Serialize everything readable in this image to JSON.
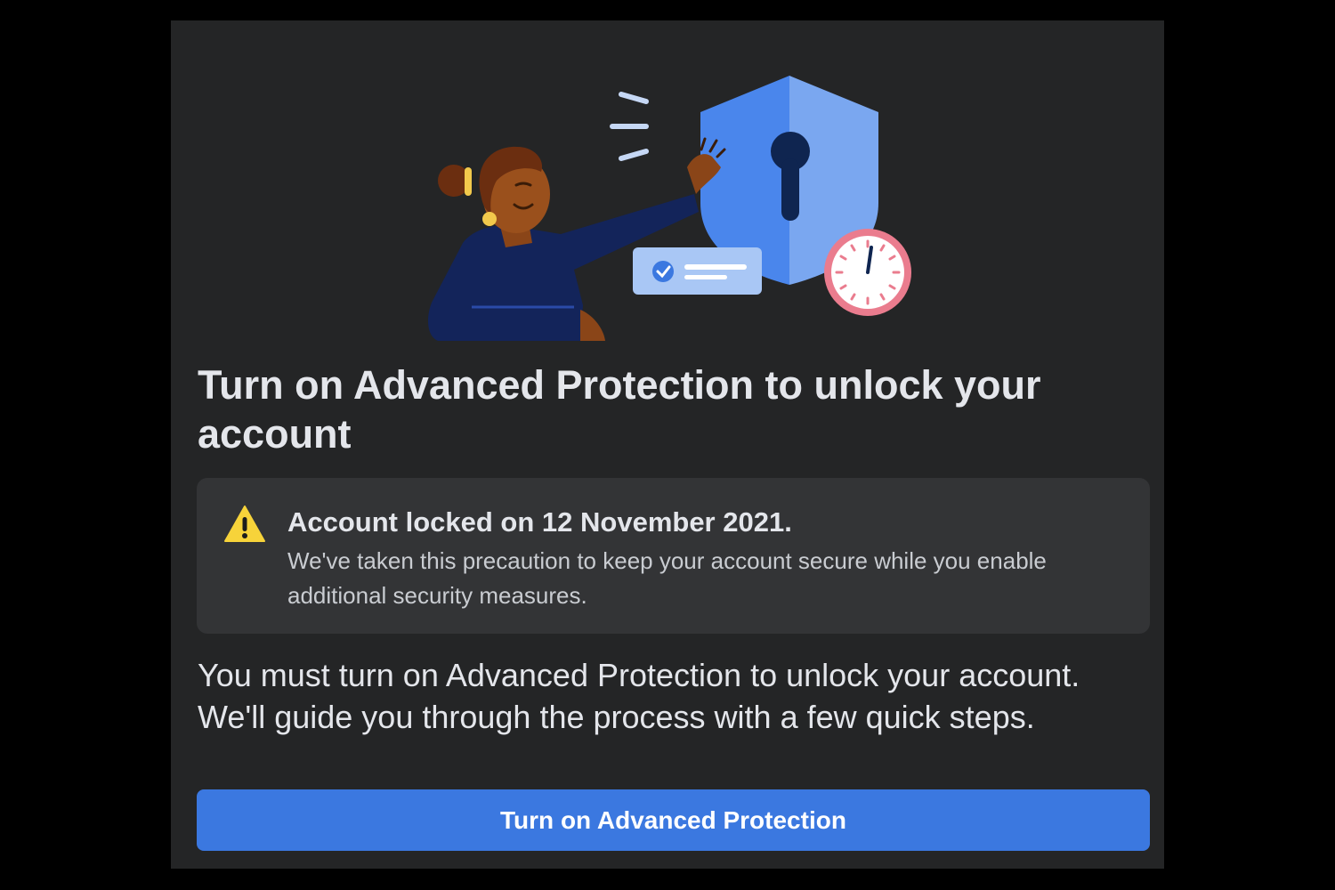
{
  "dialog": {
    "title": "Turn on Advanced Protection to unlock your account",
    "illustration_icon": "person-shield-lock-illustration",
    "notice": {
      "icon": "warning-icon",
      "title": "Account locked on 12 November 2021.",
      "body": "We've taken this precaution to keep your account secure while you enable additional security measures."
    },
    "description": "You must turn on Advanced Protection to unlock your account. We'll guide you through the process with a few quick steps.",
    "primary_button_label": "Turn on Advanced Protection"
  },
  "colors": {
    "background": "#000000",
    "panel": "#242526",
    "notice_background": "#333436",
    "accent": "#3b78e0",
    "warning": "#f7d33a",
    "shield": "#5a93f2"
  }
}
